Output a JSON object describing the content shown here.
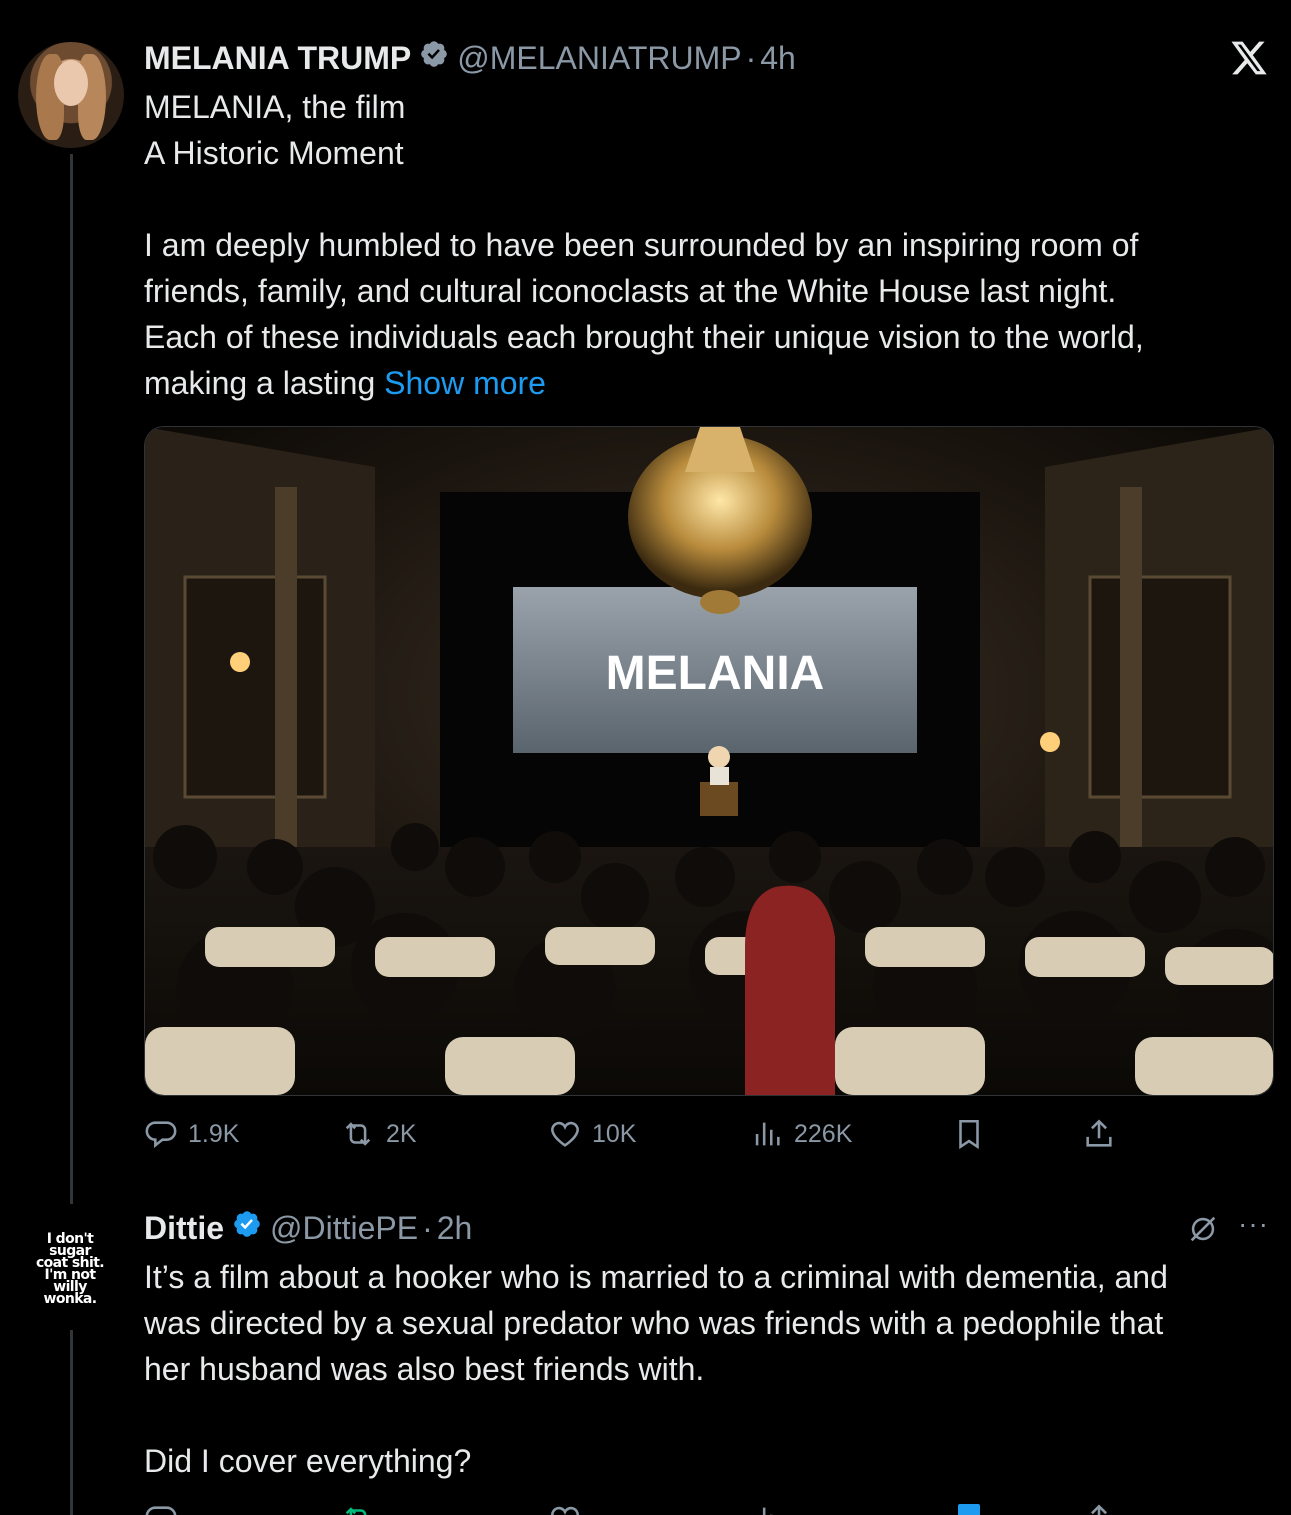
{
  "window": {
    "logo": "x-logo"
  },
  "tweet": {
    "author_name": "MELANIA TRUMP",
    "handle": "@MELANIATRUMP",
    "time": "4h",
    "separator": "·",
    "lines": [
      "MELANIA, the film",
      "A Historic Moment",
      "",
      "I am deeply humbled to have been surrounded by an inspiring room of",
      "friends, family, and cultural iconoclasts at the White House last night.",
      "Each of these individuals each brought their unique vision to the world,",
      "making a lasting"
    ],
    "show_more": "Show more",
    "media": {
      "screen_text": "MELANIA"
    },
    "stats": {
      "replies": "1.9K",
      "reposts": "2K",
      "likes": "10K",
      "views": "226K"
    }
  },
  "reply": {
    "author_name": "Dittie",
    "handle": "@DittiePE",
    "time": "2h",
    "separator": "·",
    "avatar_text": "I don't sugar coat shit. I'm not willy wonka.",
    "lines": [
      "It’s a film about a hooker who is married to a criminal with dementia, and",
      "was directed by a sexual predator who was friends with a pedophile that",
      "her husband was also best friends with.",
      "",
      "Did I cover everything?"
    ],
    "more_label": "···"
  },
  "colors": {
    "background": "#000000",
    "text": "#e7e9ea",
    "secondary": "#8b98a5",
    "link": "#1d9bf0",
    "verified": "#1d9bf0"
  }
}
